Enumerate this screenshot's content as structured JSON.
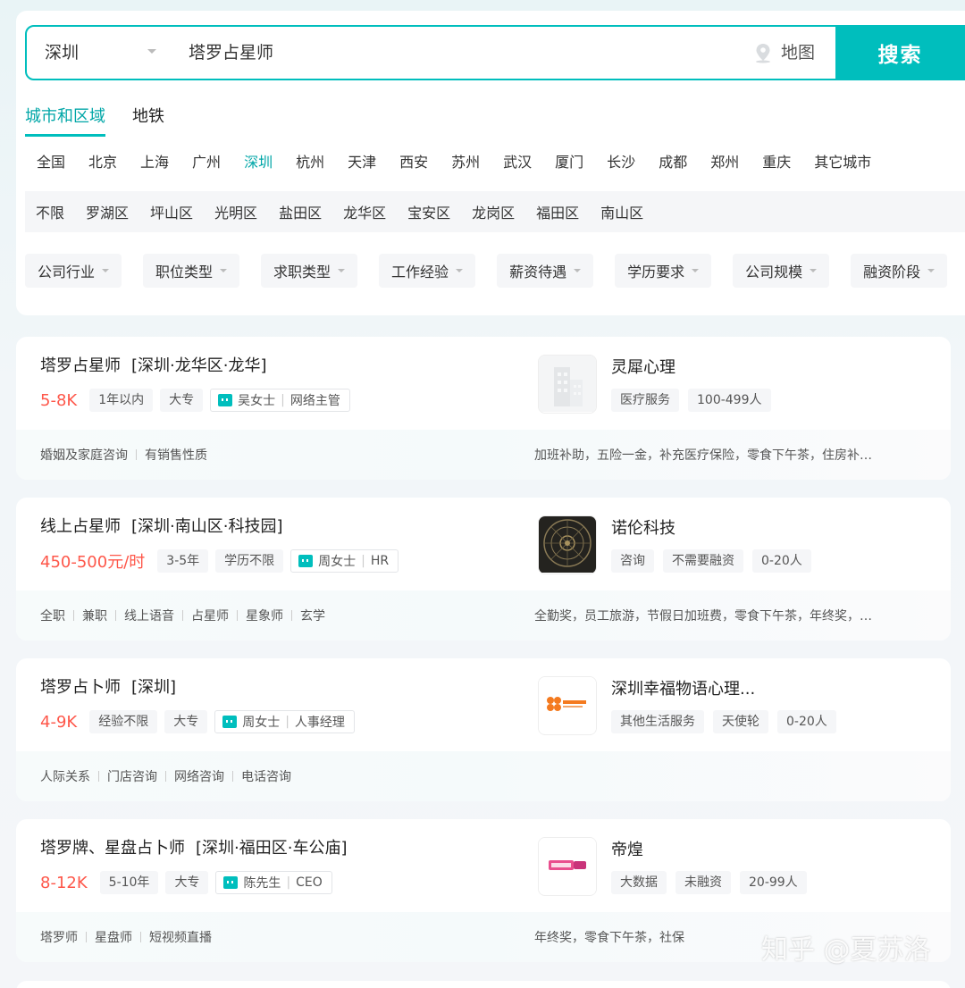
{
  "search": {
    "city": "深圳",
    "query": "塔罗占星师",
    "map_label": "地图",
    "button_label": "搜索"
  },
  "tabs": [
    "城市和区域",
    "地铁"
  ],
  "cities": [
    "全国",
    "北京",
    "上海",
    "广州",
    "深圳",
    "杭州",
    "天津",
    "西安",
    "苏州",
    "武汉",
    "厦门",
    "长沙",
    "成都",
    "郑州",
    "重庆",
    "其它城市"
  ],
  "active_city": "深圳",
  "districts": [
    "不限",
    "罗湖区",
    "坪山区",
    "光明区",
    "盐田区",
    "龙华区",
    "宝安区",
    "龙岗区",
    "福田区",
    "南山区"
  ],
  "filters": [
    "公司行业",
    "职位类型",
    "求职类型",
    "工作经验",
    "薪资待遇",
    "学历要求",
    "公司规模",
    "融资阶段"
  ],
  "colors": {
    "accent": "#00bebd",
    "salary": "#fe574a"
  },
  "jobs": [
    {
      "title": "塔罗占星师",
      "location": "[深圳·龙华区·龙华]",
      "salary": "5-8K",
      "tags": [
        "1年以内",
        "大专"
      ],
      "recruiter": "吴女士",
      "recruiter_role": "网络主管",
      "company": "灵犀心理",
      "company_tags": [
        "医疗服务",
        "100-499人"
      ],
      "skills": [
        "婚姻及家庭咨询",
        "有销售性质"
      ],
      "welfare": "加班补助，五险一金，补充医疗保险，零食下午茶，住房补…",
      "logo": "building-icon"
    },
    {
      "title": "线上占星师",
      "location": "[深圳·南山区·科技园]",
      "salary": "450-500元/时",
      "tags": [
        "3-5年",
        "学历不限"
      ],
      "recruiter": "周女士",
      "recruiter_role": "HR",
      "company": "诺伦科技",
      "company_tags": [
        "咨询",
        "不需要融资",
        "0-20人"
      ],
      "skills": [
        "全职",
        "兼职",
        "线上语音",
        "占星师",
        "星象师",
        "玄学"
      ],
      "welfare": "全勤奖，员工旅游，节假日加班费，零食下午茶，年终奖，…",
      "logo": "astrology-dial-logo"
    },
    {
      "title": "塔罗占卜师",
      "location": "[深圳]",
      "salary": "4-9K",
      "tags": [
        "经验不限",
        "大专"
      ],
      "recruiter": "周女士",
      "recruiter_role": "人事经理",
      "company": "深圳幸福物语心理...",
      "company_tags": [
        "其他生活服务",
        "天使轮",
        "0-20人"
      ],
      "skills": [
        "人际关系",
        "门店咨询",
        "网络咨询",
        "电话咨询"
      ],
      "welfare": "",
      "logo": "clover-logo"
    },
    {
      "title": "塔罗牌、星盘占卜师",
      "location": "[深圳·福田区·车公庙]",
      "salary": "8-12K",
      "tags": [
        "5-10年",
        "大专"
      ],
      "recruiter": "陈先生",
      "recruiter_role": "CEO",
      "company": "帝煌",
      "company_tags": [
        "大数据",
        "未融资",
        "20-99人"
      ],
      "skills": [
        "塔罗师",
        "星盘师",
        "短视频直播"
      ],
      "welfare": "年终奖，零食下午茶，社保",
      "logo": "text-logo"
    }
  ],
  "watermark": "知乎 @夏苏洛"
}
